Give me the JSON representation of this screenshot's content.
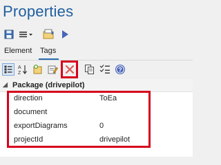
{
  "window": {
    "title": "Properties"
  },
  "tabs": [
    {
      "label": "Element"
    },
    {
      "label": "Tags"
    }
  ],
  "group": {
    "label": "Package (drivepilot)"
  },
  "properties": [
    {
      "name": "direction",
      "value": "ToEa"
    },
    {
      "name": "document",
      "value": ""
    },
    {
      "name": "exportDiagrams",
      "value": "0"
    },
    {
      "name": "projectId",
      "value": "drivepilot"
    }
  ],
  "colors": {
    "title": "#1f5fa0",
    "highlight": "#d6001c",
    "accent": "#2b6cb0"
  },
  "icons": {
    "toolbar1": [
      "save-icon",
      "menu-icon",
      "properties-icon",
      "play-icon"
    ],
    "toolbar2": [
      "categorized-icon",
      "sort-az-icon",
      "add-tag-icon",
      "edit-tag-icon",
      "delete-icon",
      "copy-icon",
      "checklist-icon",
      "help-icon"
    ]
  }
}
